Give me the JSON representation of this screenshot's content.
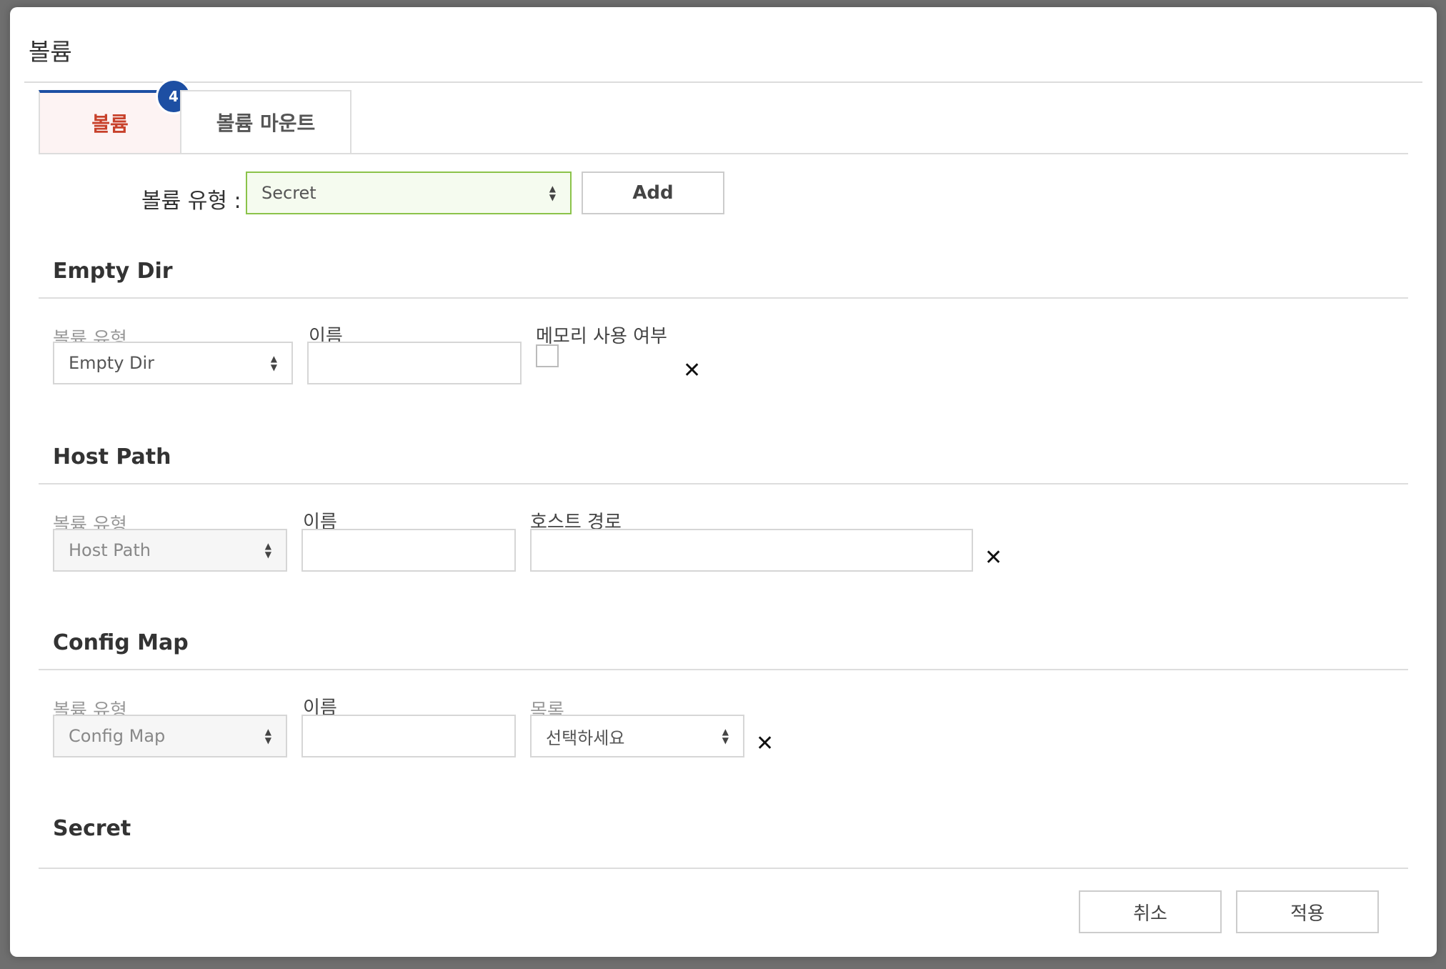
{
  "modal": {
    "title": "볼륨"
  },
  "tabs": [
    {
      "label": "볼륨",
      "badge": "4",
      "active": true
    },
    {
      "label": "볼륨 마운트",
      "active": false
    }
  ],
  "volume_type_row": {
    "label": "볼륨 유형 :",
    "selected": "Secret",
    "add_label": "Add"
  },
  "sections": {
    "empty_dir": {
      "title": "Empty Dir",
      "type_label": "볼륨 유형",
      "type_value": "Empty Dir",
      "name_label": "이름",
      "memory_label": "메모리 사용 여부"
    },
    "host_path": {
      "title": "Host Path",
      "type_label": "볼륨 유형",
      "type_value": "Host Path",
      "name_label": "이름",
      "host_path_label": "호스트 경로"
    },
    "config_map": {
      "title": "Config Map",
      "type_label": "볼륨 유형",
      "type_value": "Config Map",
      "name_label": "이름",
      "list_label": "목록",
      "list_placeholder": "선택하세요"
    },
    "secret": {
      "title": "Secret"
    }
  },
  "icons": {
    "remove": "close-icon",
    "select_arrows": "updown-arrows-icon"
  },
  "remove_glyph": "✕",
  "footer": {
    "cancel_label": "취소",
    "apply_label": "적용"
  },
  "colors": {
    "accent": "#1d4fa3",
    "active_tab_text": "#c8412b",
    "select_highlight_border": "#8bc34a"
  }
}
